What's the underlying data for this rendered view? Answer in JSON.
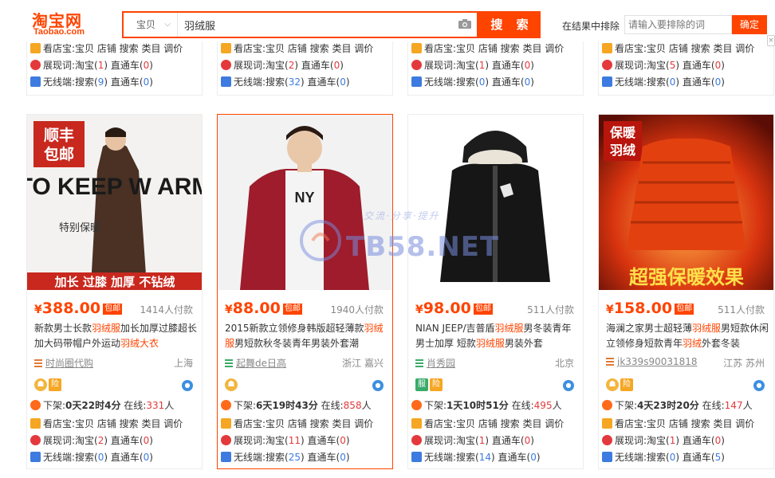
{
  "header": {
    "logo_main": "淘宝网",
    "logo_sub": "Taobao.com",
    "search_category": "宝贝",
    "search_query": "羽绒服",
    "search_button": "搜 索",
    "exclude_label": "在结果中排除",
    "exclude_placeholder": "请输入要排除的词",
    "exclude_button": "确定"
  },
  "labels": {
    "store_tags": "看店宝:宝贝 店铺 搜索 类目 调价",
    "exposure_prefix": "展现词:淘宝",
    "mobile_prefix": "无线端:搜索",
    "ztc": "直通车",
    "offshelf": "下架:",
    "online": "在线:",
    "person": "人",
    "pinyou": "包邮",
    "yen": "¥",
    "insurance": "险",
    "clothing": "服"
  },
  "top_cards": [
    {
      "exposure": "1",
      "exposure_ztc": "0",
      "mobile": "9",
      "mobile_ztc": "0"
    },
    {
      "exposure": "2",
      "exposure_ztc": "0",
      "mobile": "32",
      "mobile_ztc": "0"
    },
    {
      "exposure": "1",
      "exposure_ztc": "0",
      "mobile": "0",
      "mobile_ztc": "0"
    },
    {
      "exposure": "5",
      "exposure_ztc": "0",
      "mobile": "0",
      "mobile_ztc": "0"
    }
  ],
  "products": [
    {
      "image_text": [
        "顺丰",
        "包邮",
        "TO KEEP W ARM",
        "特别保暖",
        "加长 过膝 加厚 不钻绒"
      ],
      "price": "388.00",
      "sold": "1414人付款",
      "title_parts": [
        "新款男士长款",
        "羽绒服",
        "加长加厚过膝超长加大码带帽户外运动",
        "羽绒",
        "大衣"
      ],
      "shop": "时尚圈代购",
      "location": "上海",
      "offshelf": "0天22时4分",
      "online": "331",
      "exposure": "2",
      "exposure_ztc": "0",
      "mobile": "0",
      "mobile_ztc": "0"
    },
    {
      "image_text": [
        "NY"
      ],
      "price": "88.00",
      "sold": "1940人付款",
      "title_parts": [
        "2015新款立领修身韩版超轻薄款",
        "羽绒",
        "服",
        "男短款秋冬装青年男装外套潮"
      ],
      "shop": "起舞de日高",
      "location": "浙江 嘉兴",
      "offshelf": "6天19时43分",
      "online": "858",
      "exposure": "11",
      "exposure_ztc": "0",
      "mobile": "25",
      "mobile_ztc": "0"
    },
    {
      "image_text": [],
      "price": "98.00",
      "sold": "511人付款",
      "title_parts": [
        "NIAN JEEP/吉普盾",
        "羽绒服",
        "男冬装青年男士加厚 短款",
        "羽绒服",
        "男装外套"
      ],
      "shop": "肖秀园",
      "location": "北京",
      "offshelf": "1天10时51分",
      "online": "495",
      "exposure": "1",
      "exposure_ztc": "0",
      "mobile": "14",
      "mobile_ztc": "0"
    },
    {
      "image_text": [
        "保暖",
        "羽绒",
        "超强保暖效果"
      ],
      "price": "158.00",
      "sold": "511人付款",
      "title_parts": [
        "海澜之家男士超轻薄",
        "羽绒服",
        "男短款休闲立领修身短款青年",
        "羽绒",
        "外套冬装"
      ],
      "shop": "jk339s90031818",
      "location": "江苏 苏州",
      "offshelf": "4天23时20分",
      "online": "147",
      "exposure": "1",
      "exposure_ztc": "0",
      "mobile": "0",
      "mobile_ztc": "5"
    }
  ],
  "watermark": {
    "main": "TB58.NET",
    "sub": "交流·分享·提升"
  }
}
